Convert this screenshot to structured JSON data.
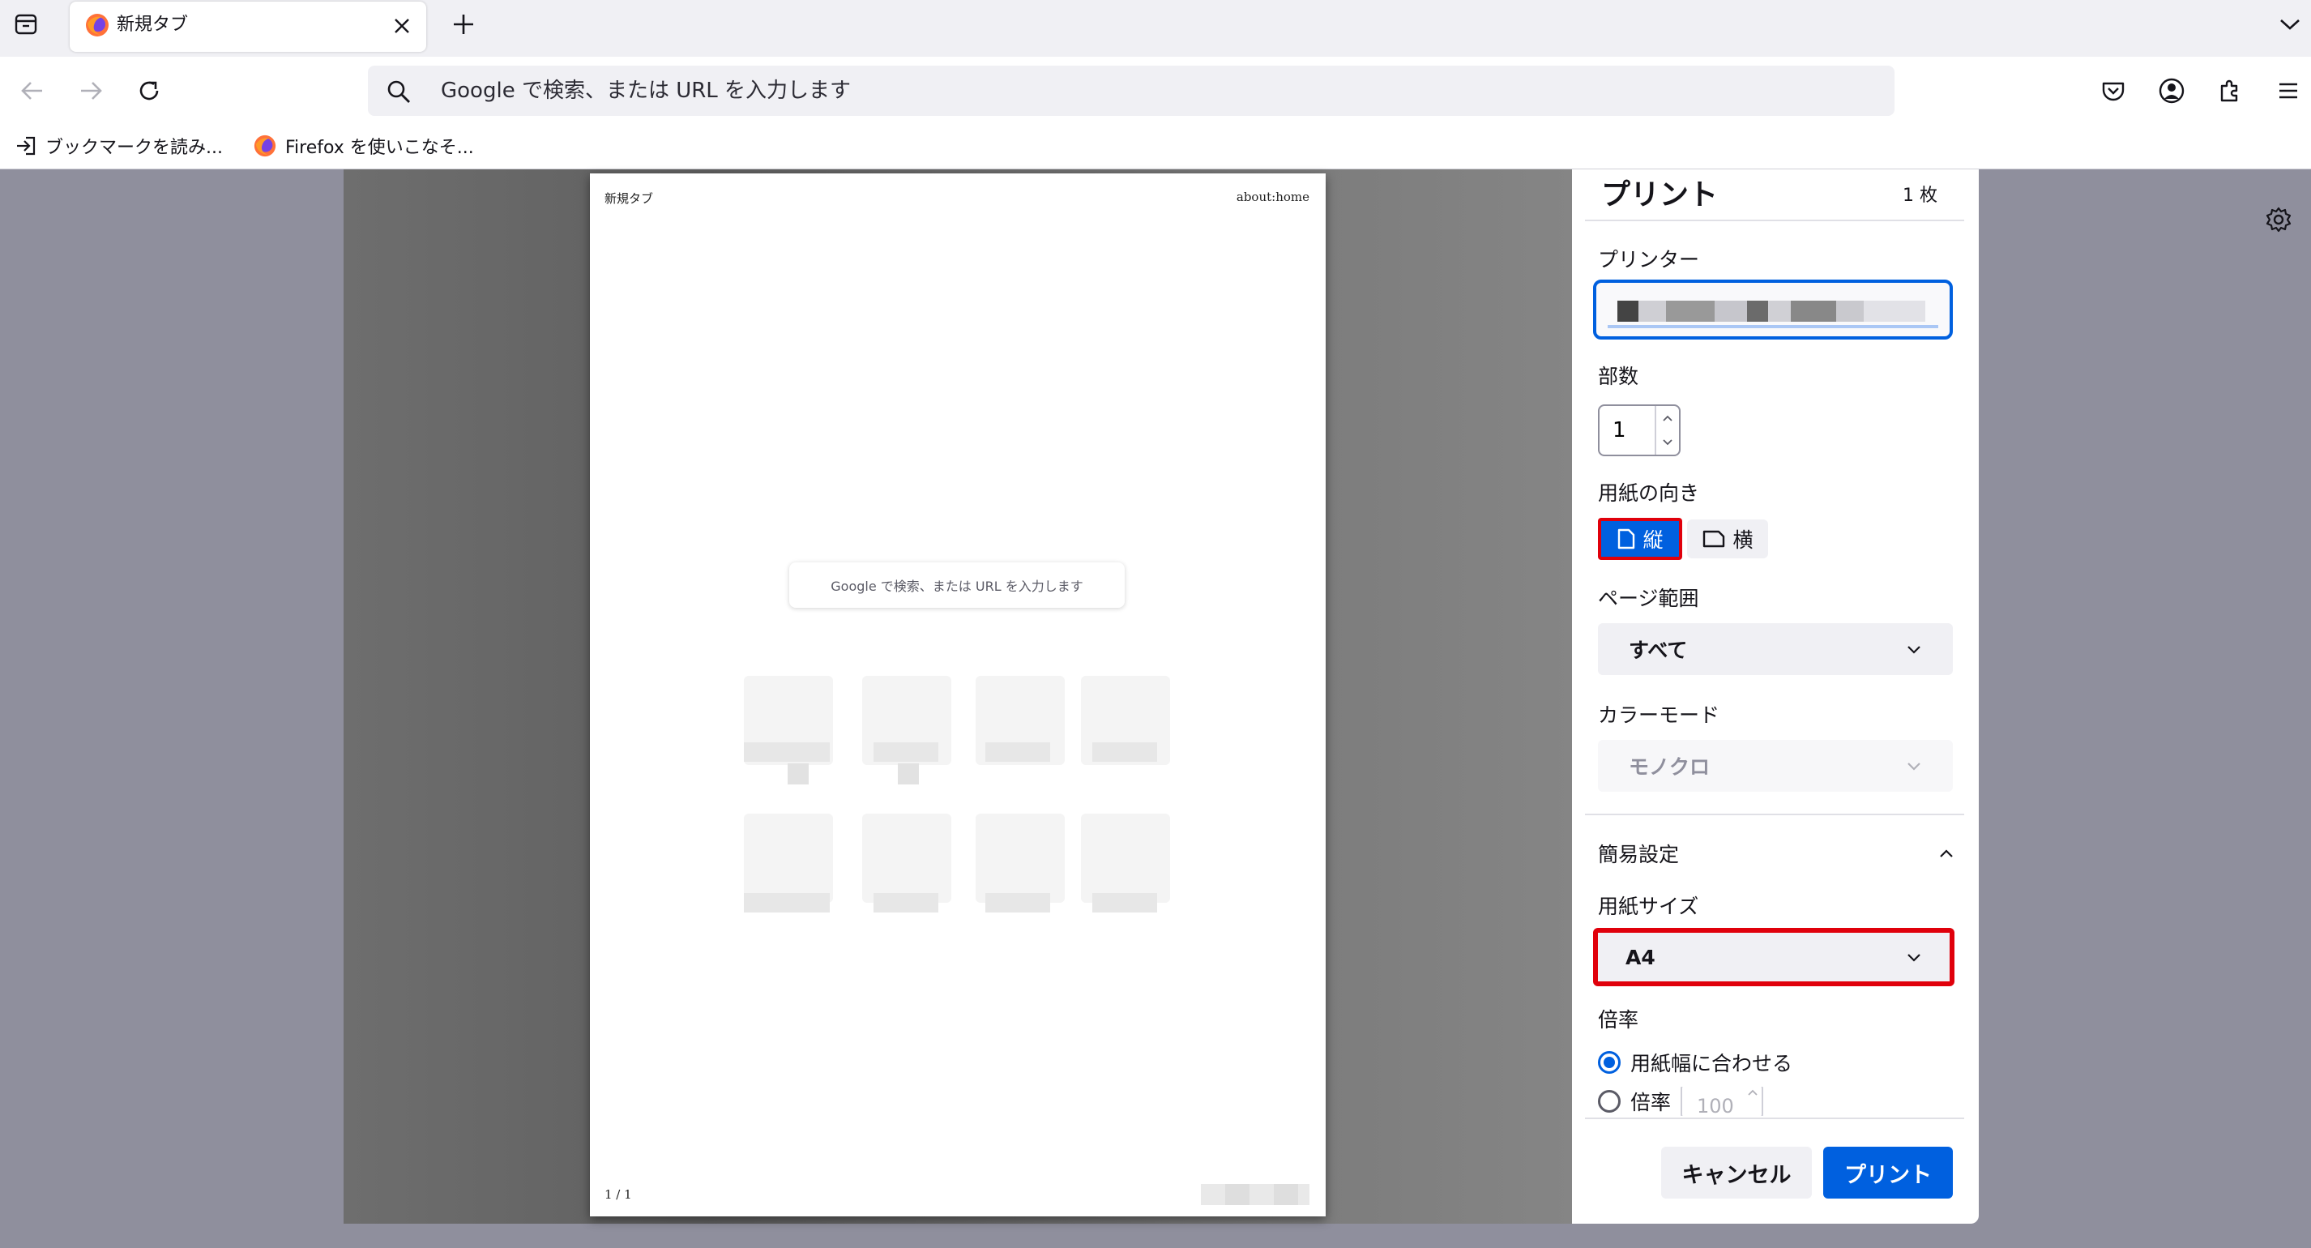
{
  "browser": {
    "tab": {
      "title": "新規タブ"
    },
    "urlbar": {
      "placeholder": "Google で検索、または URL を入力します"
    },
    "bookmarks": [
      {
        "label": "ブックマークを読み..."
      },
      {
        "label": "Firefox を使いこなそ..."
      }
    ]
  },
  "preview": {
    "header_left": "新規タブ",
    "header_right": "about:home",
    "search_text": "Google で検索、または URL を入力します",
    "footer_left": "1 / 1"
  },
  "print": {
    "title": "プリント",
    "sheet_count": "1 枚",
    "printer_label": "プリンター",
    "copies_label": "部数",
    "copies_value": "1",
    "orientation_label": "用紙の向き",
    "portrait_label": "縦",
    "landscape_label": "横",
    "range_label": "ページ範囲",
    "range_value": "すべて",
    "color_label": "カラーモード",
    "color_value": "モノクロ",
    "simple_settings": "簡易設定",
    "paper_label": "用紙サイズ",
    "paper_value": "A4",
    "scale_label": "倍率",
    "fit_width_label": "用紙幅に合わせる",
    "scale_option_label": "倍率",
    "scale_value": "100",
    "cancel": "キャンセル",
    "print": "プリント"
  },
  "colors": {
    "accent": "#0060df",
    "highlight": "#e0000b"
  }
}
